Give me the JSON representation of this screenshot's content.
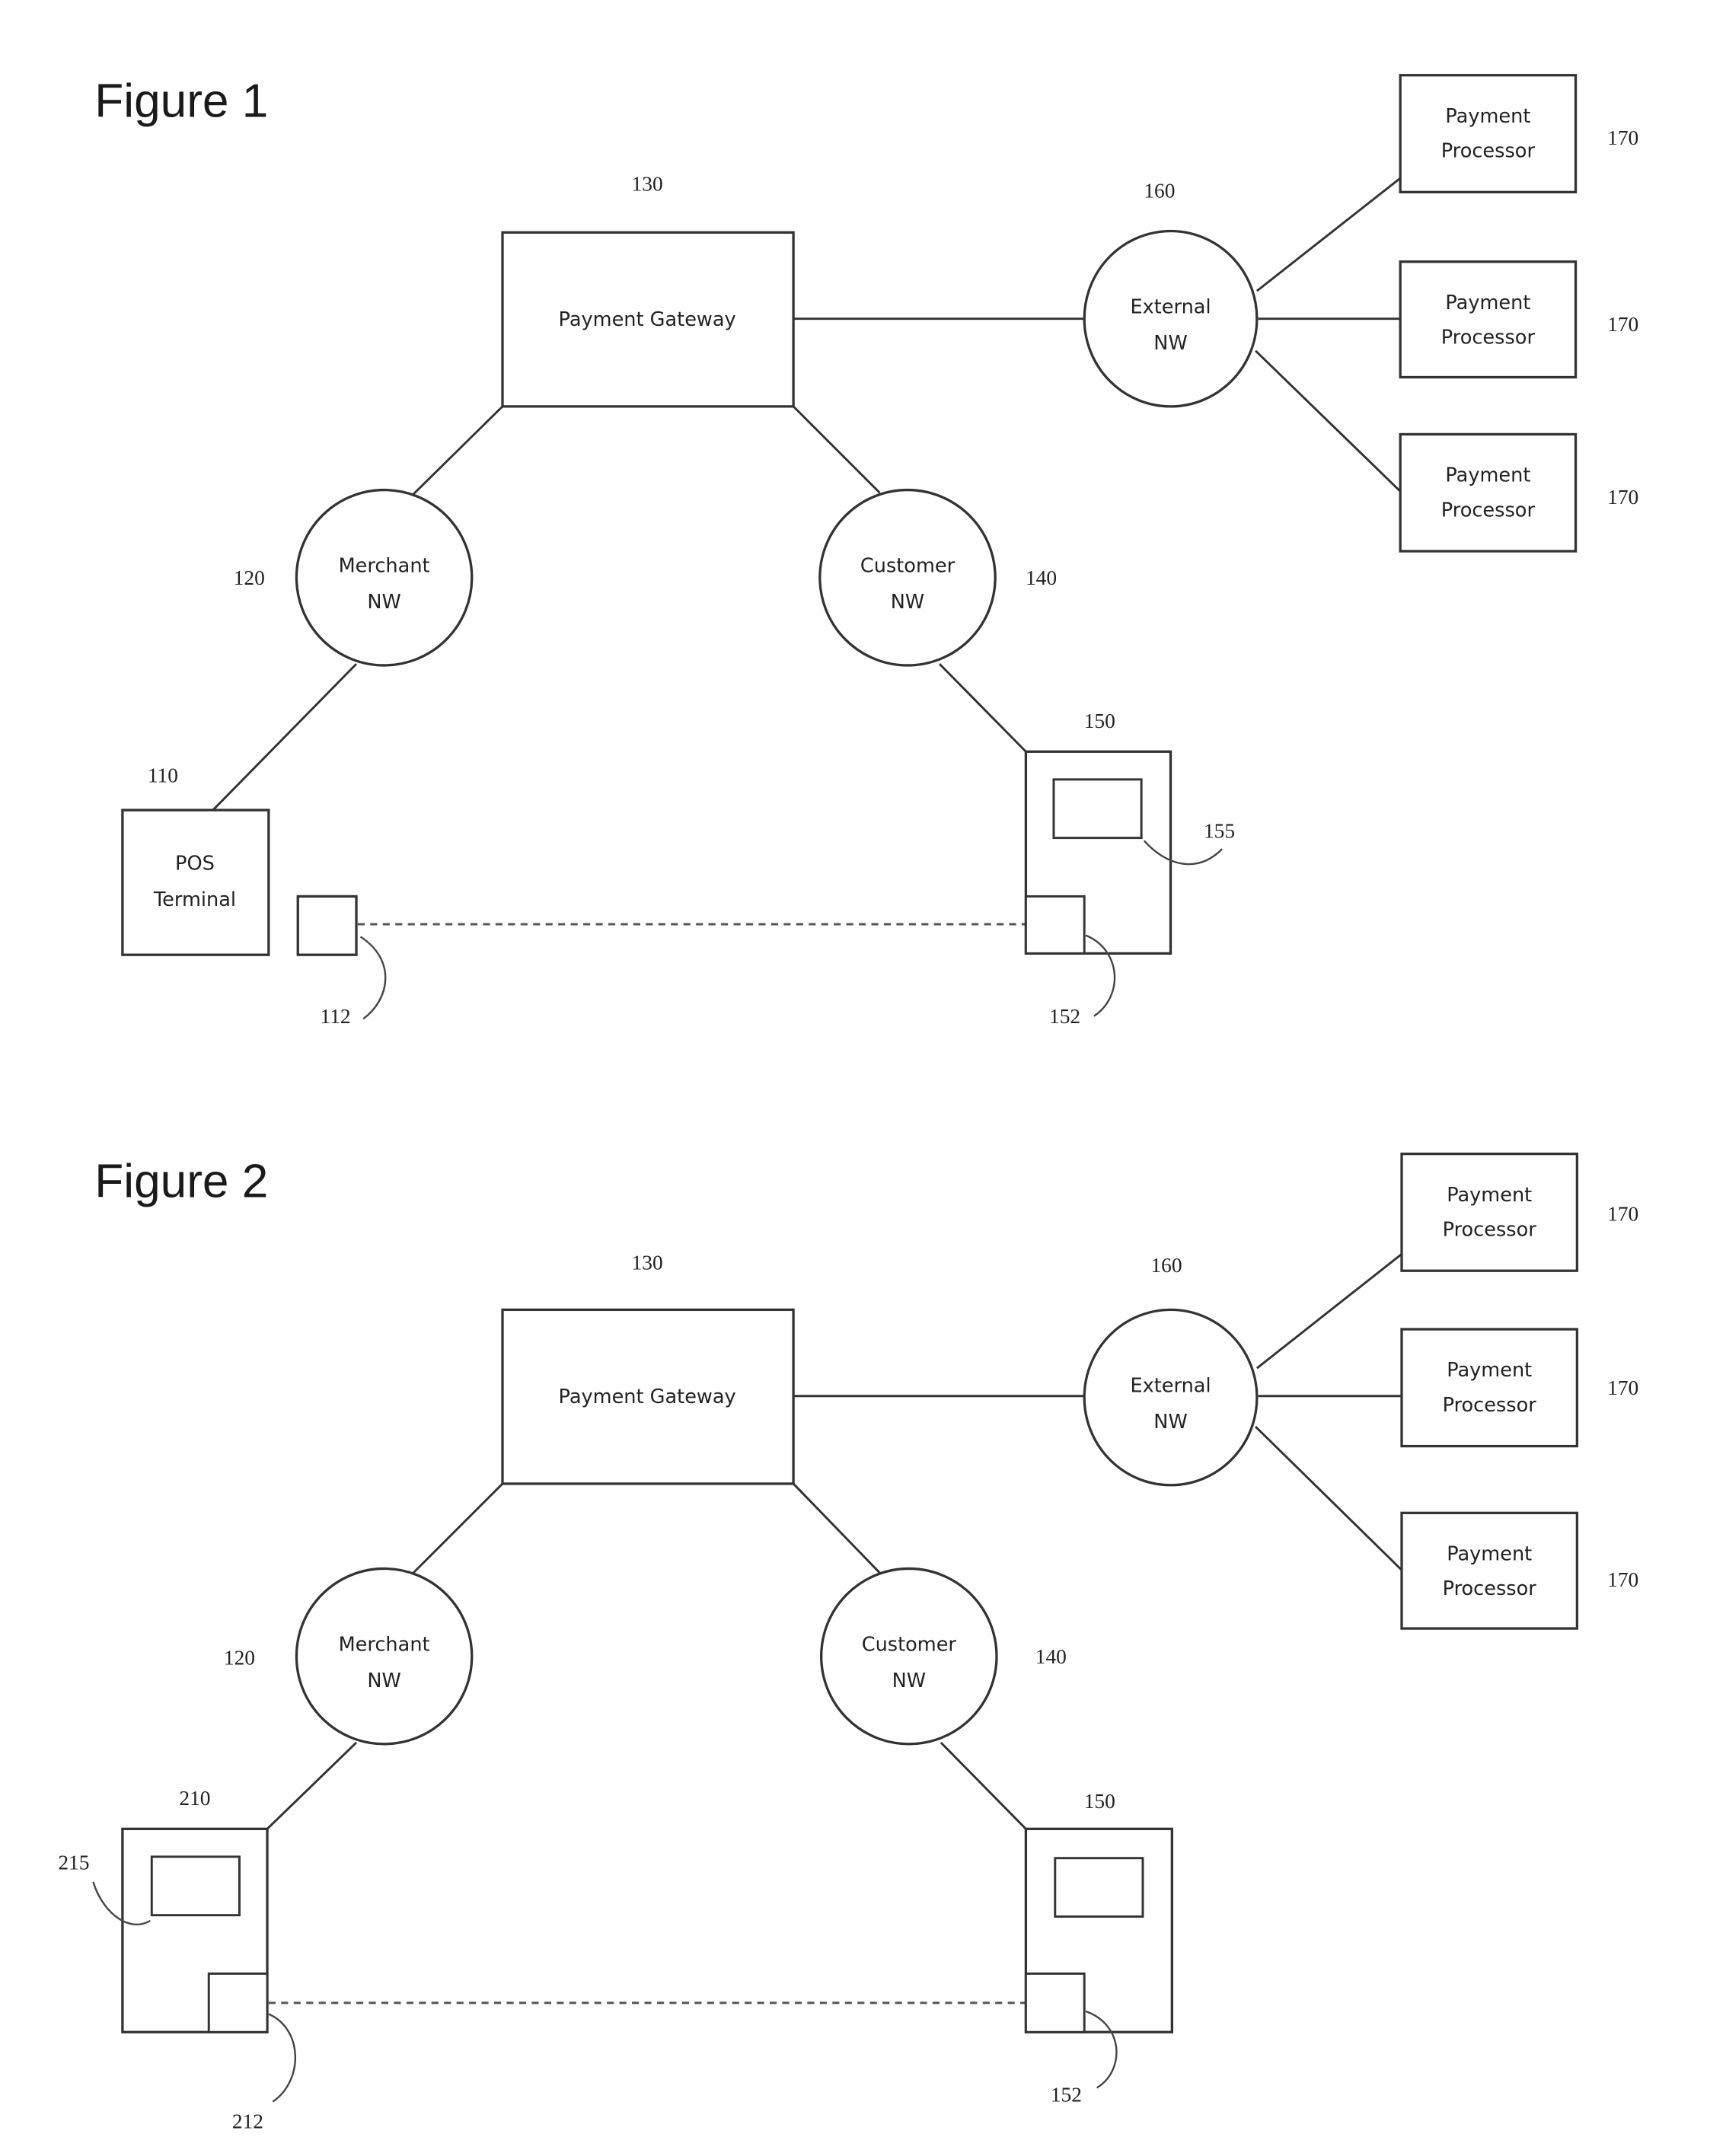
{
  "figures": [
    {
      "title": "Figure 1",
      "nodes": {
        "payment_gateway": {
          "ref": "130",
          "label": "Payment Gateway"
        },
        "merchant_nw": {
          "ref": "120",
          "label_line1": "Merchant",
          "label_line2": "NW"
        },
        "customer_nw": {
          "ref": "140",
          "label_line1": "Customer",
          "label_line2": "NW"
        },
        "external_nw": {
          "ref": "160",
          "label_line1": "External",
          "label_line2": "NW"
        },
        "processors": [
          {
            "ref": "170",
            "label_line1": "Payment",
            "label_line2": "Processor"
          },
          {
            "ref": "170",
            "label_line1": "Payment",
            "label_line2": "Processor"
          },
          {
            "ref": "170",
            "label_line1": "Payment",
            "label_line2": "Processor"
          }
        ],
        "pos_terminal": {
          "ref": "110",
          "label_line1": "POS",
          "label_line2": "Terminal"
        },
        "pos_reader": {
          "ref": "112"
        },
        "customer_device": {
          "ref": "150"
        },
        "customer_device_screen": {
          "ref": "155"
        },
        "customer_device_reader": {
          "ref": "152"
        }
      }
    },
    {
      "title": "Figure 2",
      "nodes": {
        "payment_gateway": {
          "ref": "130",
          "label": "Payment Gateway"
        },
        "merchant_nw": {
          "ref": "120",
          "label_line1": "Merchant",
          "label_line2": "NW"
        },
        "customer_nw": {
          "ref": "140",
          "label_line1": "Customer",
          "label_line2": "NW"
        },
        "external_nw": {
          "ref": "160",
          "label_line1": "External",
          "label_line2": "NW"
        },
        "processors": [
          {
            "ref": "170",
            "label_line1": "Payment",
            "label_line2": "Processor"
          },
          {
            "ref": "170",
            "label_line1": "Payment",
            "label_line2": "Processor"
          },
          {
            "ref": "170",
            "label_line1": "Payment",
            "label_line2": "Processor"
          }
        ],
        "merchant_device": {
          "ref": "210"
        },
        "merchant_device_screen": {
          "ref": "215"
        },
        "merchant_device_reader": {
          "ref": "212"
        },
        "customer_device": {
          "ref": "150"
        },
        "customer_device_reader": {
          "ref": "152"
        }
      }
    }
  ]
}
